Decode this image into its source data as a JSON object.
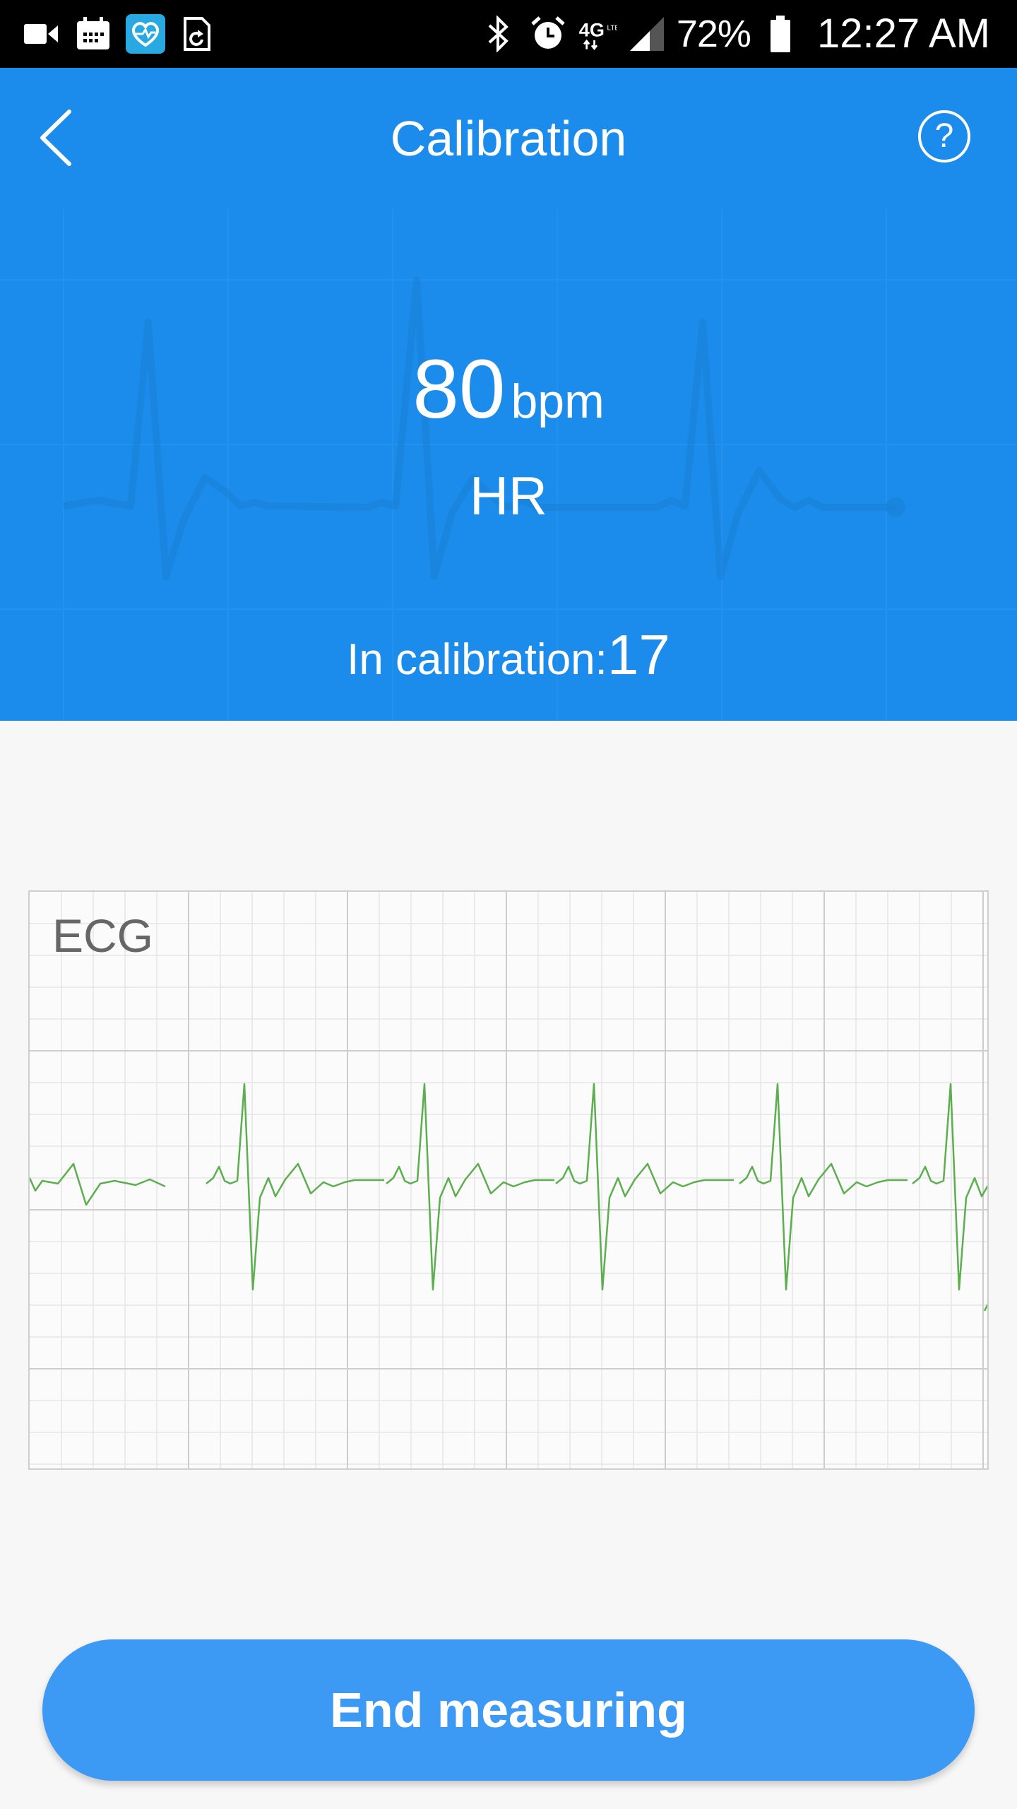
{
  "status_bar": {
    "left_icons": [
      "video-camera-icon",
      "calendar-icon",
      "heart-app-icon",
      "sync-document-icon"
    ],
    "right_icons": [
      "bluetooth-icon",
      "alarm-icon",
      "network-4g-lte-icon",
      "signal-icon"
    ],
    "network": "4G",
    "battery": "72%",
    "time": "12:27 AM"
  },
  "header": {
    "title": "Calibration",
    "back_icon": "chevron-left-icon",
    "help_icon": "question-icon",
    "help_glyph": "?",
    "heart_rate_value": "80",
    "heart_rate_unit": "bpm",
    "heart_rate_label": "HR",
    "calibration_label": "In calibration:",
    "calibration_value": "17",
    "background_color": "#1b8ceb"
  },
  "ecg": {
    "label": "ECG",
    "trace_color": "#5cae4e"
  },
  "actions": {
    "end_measuring_label": "End measuring",
    "button_color": "#3c99f4"
  }
}
